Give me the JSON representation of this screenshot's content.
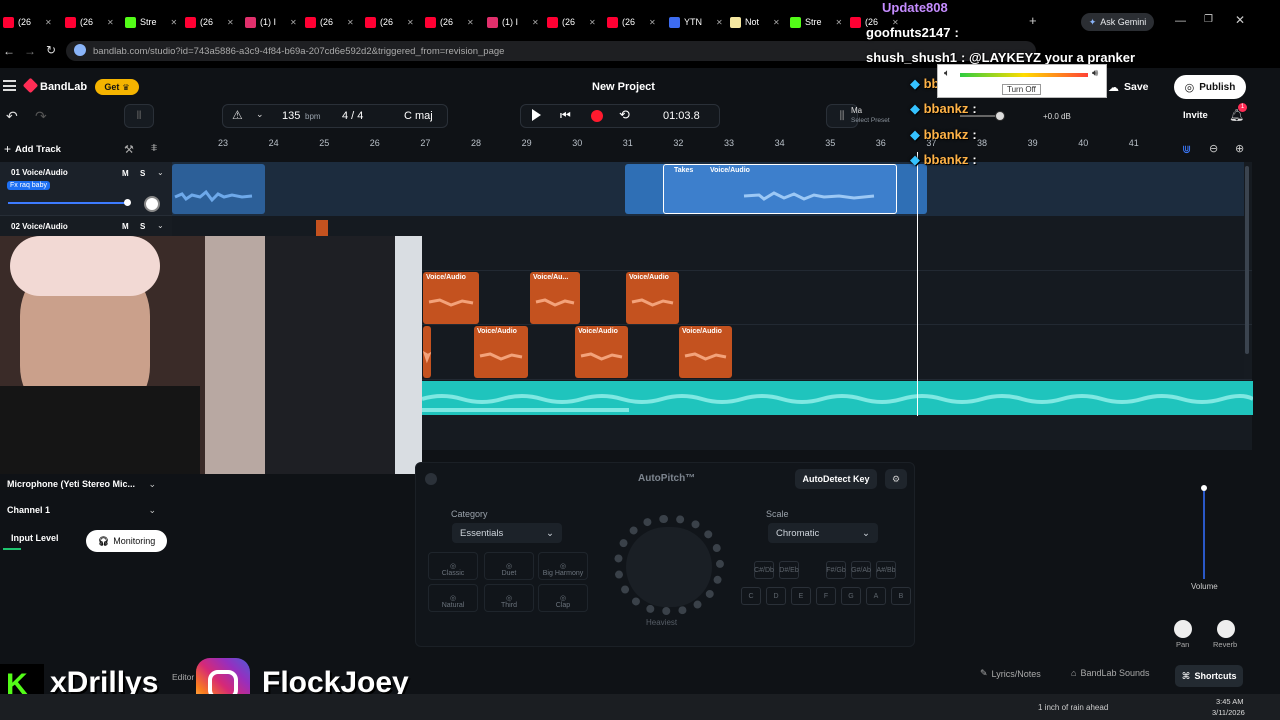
{
  "browser": {
    "tabs": [
      {
        "label": "(26",
        "icon": "youtube-icon",
        "color": "#ff0033"
      },
      {
        "label": "(26",
        "icon": "youtube-icon",
        "color": "#ff0033"
      },
      {
        "label": "Stre",
        "icon": "kick-icon",
        "color": "#53fc18"
      },
      {
        "label": "(26",
        "icon": "youtube-icon",
        "color": "#ff0033"
      },
      {
        "label": "(1) I",
        "icon": "instagram-icon",
        "color": "#e1306c"
      },
      {
        "label": "(26",
        "icon": "youtube-icon",
        "color": "#ff0033"
      },
      {
        "label": "(26",
        "icon": "youtube-icon",
        "color": "#ff0033"
      },
      {
        "label": "(26",
        "icon": "youtube-icon",
        "color": "#ff0033"
      },
      {
        "label": "(1) I",
        "icon": "instagram-icon",
        "color": "#e1306c"
      },
      {
        "label": "(26",
        "icon": "youtube-icon",
        "color": "#ff0033"
      },
      {
        "label": "(26",
        "icon": "youtube-icon",
        "color": "#ff0033"
      },
      {
        "label": "YTN",
        "icon": "shield-icon",
        "color": "#3d6cf0"
      },
      {
        "label": "Not",
        "icon": "notes-icon",
        "color": "#f5e7a0"
      },
      {
        "label": "Stre",
        "icon": "kick-icon",
        "color": "#53fc18"
      },
      {
        "label": "(26",
        "icon": "youtube-icon",
        "color": "#ff0033"
      }
    ],
    "url": "bandlab.com/studio?id=743a5886-a3c9-4f84-b69a-207cd6e592d2&triggered_from=revision_page",
    "ask_gemini": "Ask Gemini"
  },
  "app": {
    "logo": "BandLab",
    "get_label": "Get",
    "project_title": "New Project",
    "save_label": "Save",
    "publish_label": "Publish",
    "invite_label": "Invite",
    "notif_count": "1",
    "accent": "#ff2d55"
  },
  "toolbar": {
    "bpm_value": "135",
    "bpm_unit": "bpm",
    "time_sig": "4 / 4",
    "key": "C maj",
    "time": "01:03.8",
    "master_label": "Ma",
    "preset_label": "Select Preset",
    "db_value": "+0.0 dB"
  },
  "tracks": {
    "add_track": "Add Track",
    "ruler": [
      "23",
      "24",
      "25",
      "26",
      "27",
      "28",
      "29",
      "30",
      "31",
      "32",
      "33",
      "34",
      "35",
      "36",
      "37",
      "38",
      "39",
      "40",
      "41"
    ],
    "track1": {
      "name": "01 Voice/Audio",
      "tag": "Fx raq baby",
      "m": "M",
      "s": "S"
    },
    "track2": {
      "name": "02 Voice/Audio",
      "m": "M",
      "s": "S"
    },
    "clip_label": "Voice/Audio",
    "clip_label_short": "Voice/Au...",
    "takes_label": "Takes"
  },
  "input": {
    "device": "Microphone (Yeti Stereo Mic...",
    "channel": "Channel 1",
    "input_level": "Input Level",
    "monitoring": "Monitoring"
  },
  "autopitch": {
    "title": "AutoPitch™",
    "autodetect": "AutoDetect Key",
    "category_label": "Category",
    "category_value": "Essentials",
    "scale_label": "Scale",
    "scale_value": "Chromatic",
    "presets": [
      "Classic",
      "Duet",
      "Big Harmony",
      "Natural",
      "Third",
      "Clap"
    ],
    "knob_label": "Heaviest",
    "keys_top": [
      "C#/Db",
      "D#/Eb",
      "F#/Gb",
      "G#/Ab",
      "A#/Bb"
    ],
    "keys_bottom": [
      "C",
      "D",
      "E",
      "F",
      "G",
      "A",
      "B"
    ]
  },
  "mixer": {
    "volume": "Volume",
    "pan": "Pan",
    "reverb": "Reverb"
  },
  "footer": {
    "lyrics": "Lyrics/Notes",
    "sounds": "BandLab Sounds",
    "shortcuts": "Shortcuts",
    "editor": "Editor"
  },
  "chat": [
    {
      "user": "Update808",
      "text": "",
      "color": "#c58cff"
    },
    {
      "user": "goofnuts2147",
      "text": ":",
      "color": "#ffffff"
    },
    {
      "user": "shush_shush1",
      "text": ": @LAYKEYZ your a pranker",
      "color": "#ffffff"
    },
    {
      "user": "bbankz",
      "text": ":",
      "color": "#ffb347"
    },
    {
      "user": "bbankz",
      "text": ":",
      "color": "#ffb347"
    },
    {
      "user": "bbankz",
      "text": ":",
      "color": "#ffb347"
    },
    {
      "user": "bbankz",
      "text": ":",
      "color": "#ffb347"
    }
  ],
  "popup": {
    "turn_off": "Turn Off"
  },
  "overlay": {
    "kick_name": "xDrillys",
    "ig_name": "FlockJoey"
  },
  "taskbar": {
    "weather": "1 inch of rain ahead",
    "time": "3:45 AM",
    "date": "3/11/2026"
  }
}
